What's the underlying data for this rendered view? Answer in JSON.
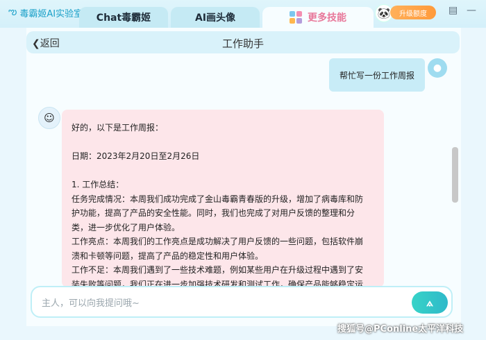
{
  "app": {
    "brand": "毒霸姬AI实验室"
  },
  "tabs": [
    {
      "label": "Chat毒霸姬"
    },
    {
      "label": "AI画头像"
    },
    {
      "label": "更多技能"
    }
  ],
  "topbar": {
    "upgrade_label": "升级额度"
  },
  "header": {
    "back_label": "返回",
    "title": "工作助手"
  },
  "chat": {
    "user_message": "帮忙写一份工作周报",
    "bot_lines": [
      "好的，以下是工作周报：",
      "",
      "日期：2023年2月20日至2月26日",
      "",
      "1. 工作总结：",
      "任务完成情况：本周我们成功完成了金山毒霸青春版的升级，增加了病毒库和防",
      "护功能，提高了产品的安全性能。同时，我们也完成了对用户反馈的整理和分",
      "类，进一步优化了用户体验。",
      "工作亮点：本周我们的工作亮点是成功解决了用户反馈的一些问题，包括软件崩",
      "溃和卡顿等问题，提高了产品的稳定性和用户体验。",
      "工作不足：本周我们遇到了一些技术难题，例如某些用户在升级过程中遇到了安",
      "装失败等问题，我们正在进一步加强技术研发和测试工作，确保产品能够稳定运"
    ]
  },
  "input": {
    "placeholder": "主人，可以向我提问哦~"
  },
  "watermark": "搜狐号@PConline太平洋科技",
  "icons": {
    "brand": "logo-icon",
    "skills": "grid-icon",
    "back": "chevron-left-icon",
    "send": "send-icon",
    "message": "message-icon",
    "minimize": "minimize-icon"
  },
  "colors": {
    "accent": "#1aa0c8",
    "pink_bubble": "#fde6ea",
    "user_bubble": "#c8ecf7",
    "upgrade": "#ff9a3a"
  }
}
